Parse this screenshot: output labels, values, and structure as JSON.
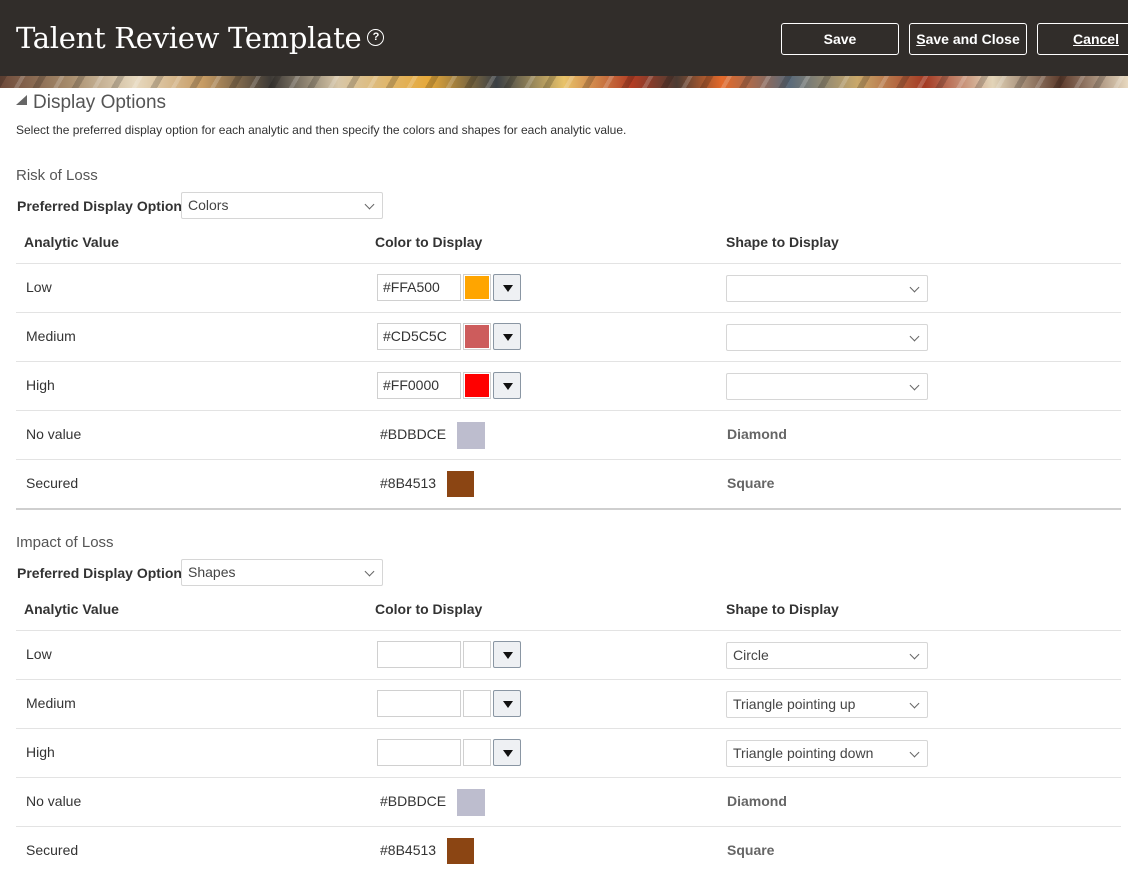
{
  "header": {
    "title": "Talent Review Template",
    "buttons": {
      "save": "Save",
      "save_close_first": "S",
      "save_close_rest": "ave and Close",
      "cancel_first": "C",
      "cancel_rest": "ancel"
    }
  },
  "section": {
    "title": "Display Options",
    "instructions": "Select the preferred display option for each analytic and then specify the colors and shapes for each analytic value."
  },
  "columns": {
    "analytic": "Analytic Value",
    "color": "Color to Display",
    "shape": "Shape to Display"
  },
  "pref_label": "Preferred Display Option",
  "groups": [
    {
      "title": "Risk of Loss",
      "preferred": "Colors",
      "rows": [
        {
          "value": "Low",
          "color": "#FFA500",
          "shape": ""
        },
        {
          "value": "Medium",
          "color": "#CD5C5C",
          "shape": ""
        },
        {
          "value": "High",
          "color": "#FF0000",
          "shape": ""
        },
        {
          "value": "No value",
          "color": "#BDBDCE",
          "shape": "Diamond"
        },
        {
          "value": "Secured",
          "color": "#8B4513",
          "shape": "Square"
        }
      ]
    },
    {
      "title": "Impact of Loss",
      "preferred": "Shapes",
      "rows": [
        {
          "value": "Low",
          "color": "",
          "shape": "Circle"
        },
        {
          "value": "Medium",
          "color": "",
          "shape": "Triangle pointing up"
        },
        {
          "value": "High",
          "color": "",
          "shape": "Triangle pointing down"
        },
        {
          "value": "No value",
          "color": "#BDBDCE",
          "shape": "Diamond"
        },
        {
          "value": "Secured",
          "color": "#8B4513",
          "shape": "Square"
        }
      ]
    }
  ]
}
